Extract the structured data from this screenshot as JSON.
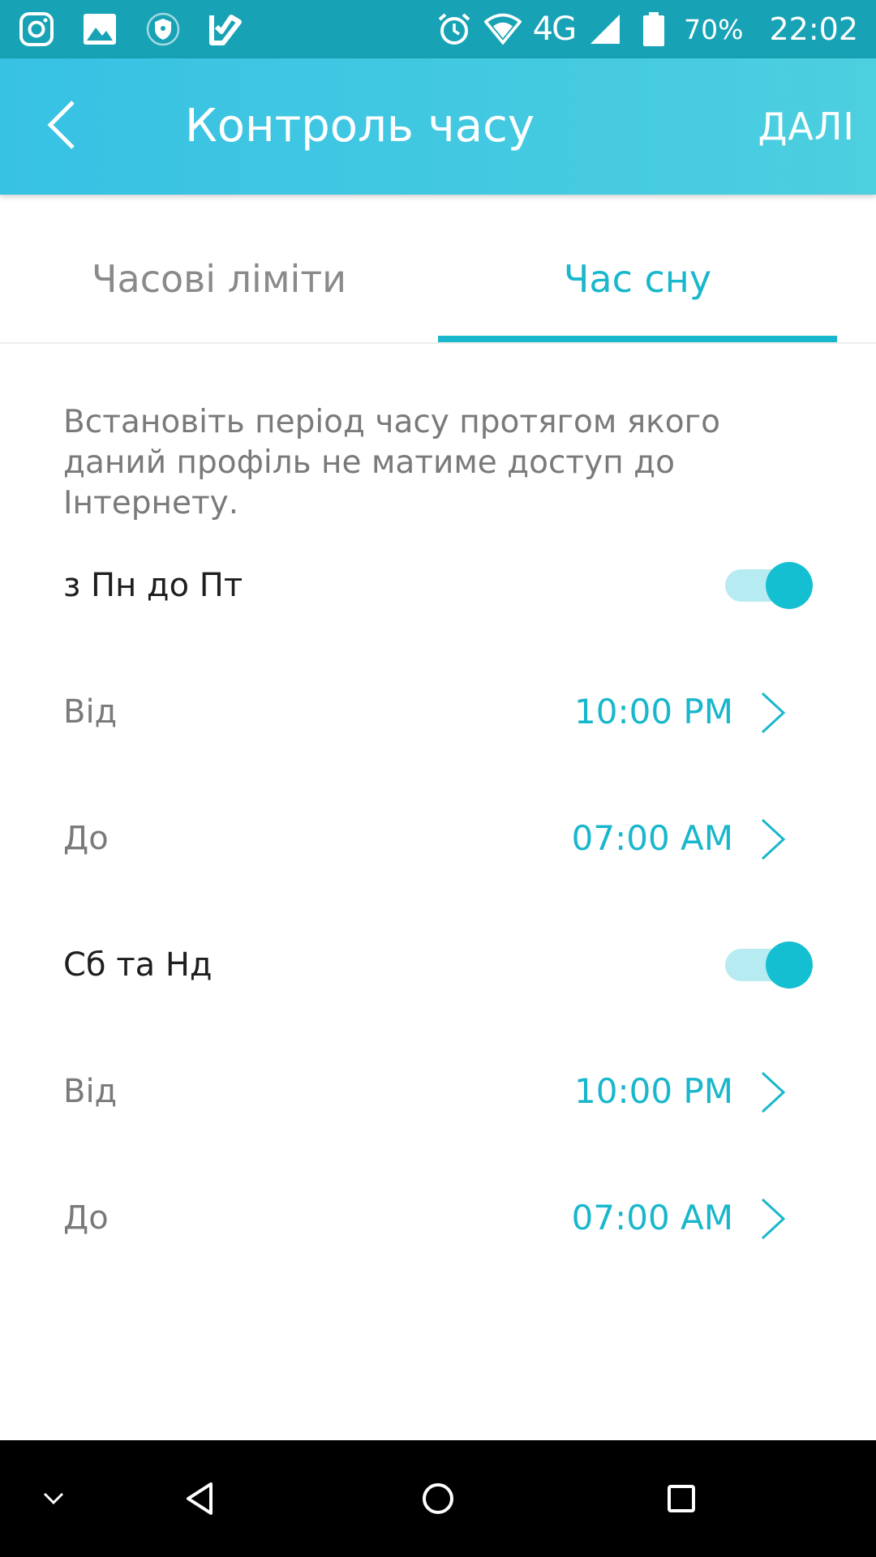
{
  "status_bar": {
    "battery": "70%",
    "network": "4G",
    "time": "22:02",
    "icons_left": [
      "instagram-icon",
      "gallery-icon",
      "shield-icon",
      "task-icon"
    ],
    "icons_right": [
      "alarm-icon",
      "wifi-icon",
      "signal-icon",
      "battery-icon"
    ]
  },
  "app_bar": {
    "title": "Контроль часу",
    "next_label": "ДАЛІ",
    "colors": {
      "start": "#37c1e3",
      "end": "#4ccfdf"
    }
  },
  "tabs": [
    {
      "label": "Часові ліміти",
      "active": false
    },
    {
      "label": "Час сну",
      "active": true
    }
  ],
  "description": "Встановіть період часу протягом якого даний профіль не матиме доступ до Інтернету.",
  "schedules": [
    {
      "label": "з Пн до Пт",
      "enabled": true,
      "from_label": "Від",
      "from_value": "10:00 PM",
      "to_label": "До",
      "to_value": "07:00 AM"
    },
    {
      "label": "Сб та Нд",
      "enabled": true,
      "from_label": "Від",
      "from_value": "10:00 PM",
      "to_label": "До",
      "to_value": "07:00 AM"
    }
  ],
  "accent_color": "#19b7cc",
  "nav_bar": [
    "chevron-down-icon",
    "back-triangle-icon",
    "home-circle-icon",
    "recents-square-icon"
  ]
}
